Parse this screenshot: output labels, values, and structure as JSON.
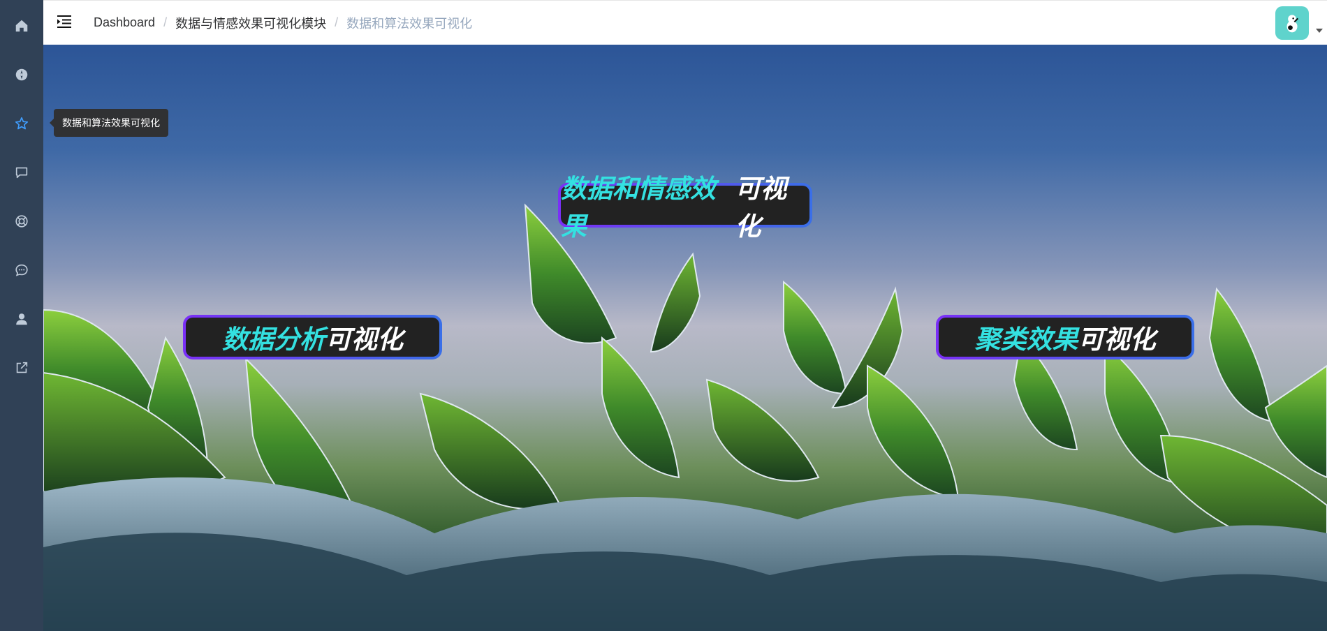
{
  "sidebar": {
    "items": [
      {
        "icon": "home-icon",
        "active": false
      },
      {
        "icon": "compass-icon",
        "active": false
      },
      {
        "icon": "star-icon",
        "active": true
      },
      {
        "icon": "message-square-icon",
        "active": false
      },
      {
        "icon": "lifebuoy-icon",
        "active": false
      },
      {
        "icon": "chat-bubble-icon",
        "active": false
      },
      {
        "icon": "user-icon",
        "active": false
      },
      {
        "icon": "external-link-icon",
        "active": false
      }
    ],
    "tooltip": "数据和算法效果可视化"
  },
  "header": {
    "breadcrumb": [
      "Dashboard",
      "数据与情感效果可视化模块",
      "数据和算法效果可视化"
    ],
    "separator": "/"
  },
  "cards": {
    "top": {
      "highlight": "数据和情感效果",
      "suffix": "可视化"
    },
    "left": {
      "highlight": "数据分析",
      "suffix": "可视化"
    },
    "right": {
      "highlight": "聚类效果",
      "suffix": "可视化"
    }
  },
  "colors": {
    "sidebar_bg": "#304156",
    "sidebar_icon": "#bfcbd9",
    "sidebar_active": "#409eff",
    "pill_highlight": "#34e1e1",
    "pill_border_start": "#7b2ff7",
    "pill_border_end": "#3a6fe8",
    "avatar_bg": "#5fd3cc"
  }
}
